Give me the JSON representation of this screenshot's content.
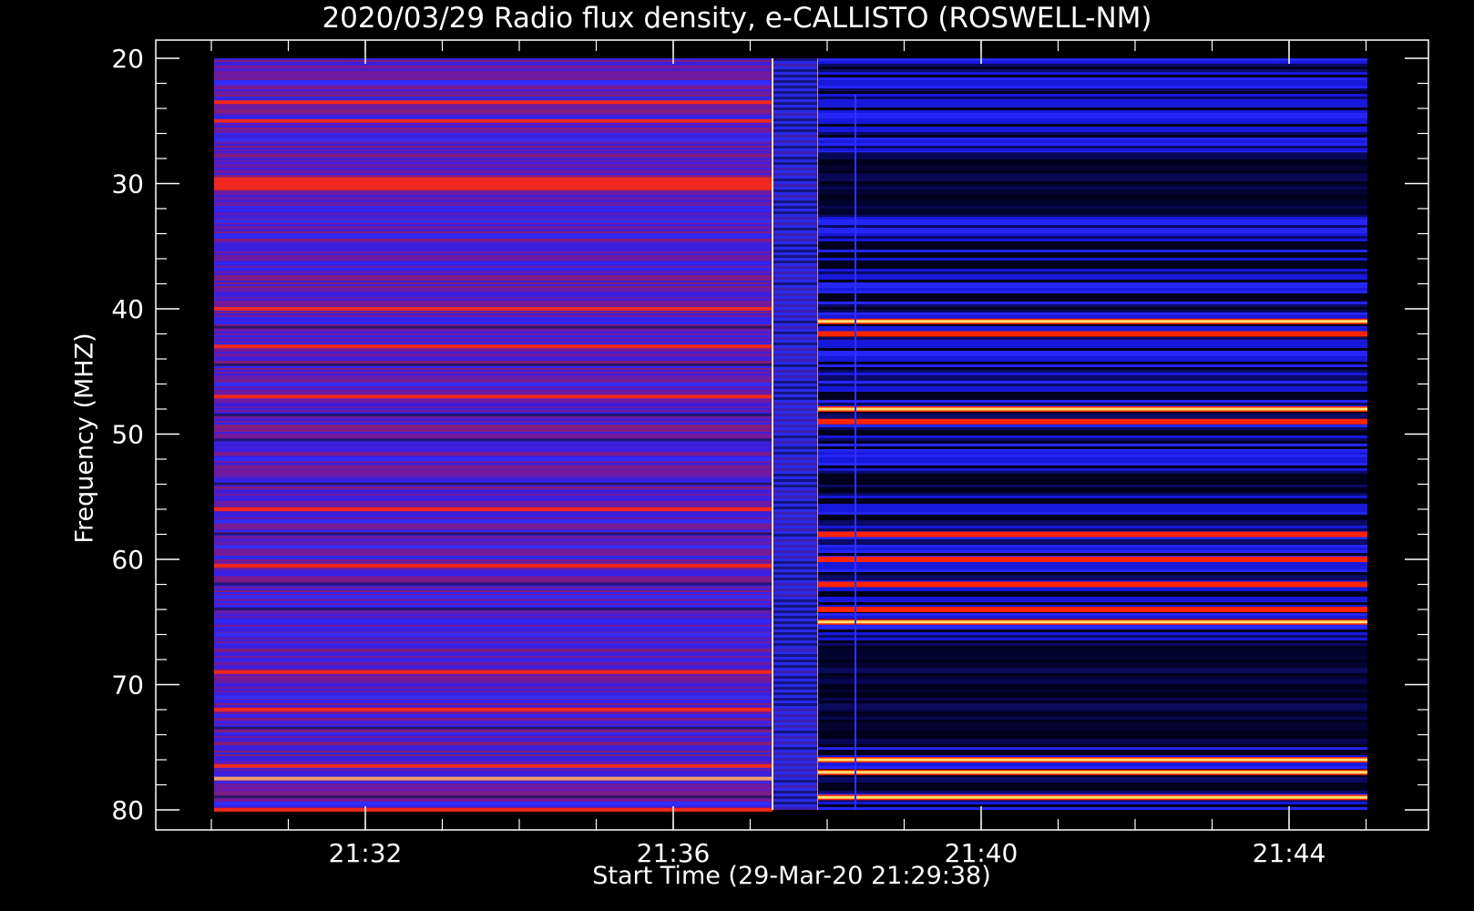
{
  "chart_data": {
    "type": "heatmap",
    "title": "2020/03/29  Radio flux density, e-CALLISTO (ROSWELL-NM)",
    "xlabel": "Start Time (29-Mar-20 21:29:38)",
    "ylabel": "Frequency (MHZ)",
    "x_ticks": [
      "21:32",
      "21:36",
      "21:40",
      "21:44"
    ],
    "y_ticks": [
      20,
      30,
      40,
      50,
      60,
      70,
      80
    ],
    "ylim": [
      80,
      20
    ],
    "x_range_min": [
      "21:29:38",
      "21:45:00"
    ],
    "colors": {
      "background": "#000000",
      "low": "#000000",
      "mid": "#2020ff",
      "high": "#ff2000",
      "peak": "#ffff80"
    },
    "features": {
      "receiver_switch_time": "21:37:50",
      "bright_bands_mhz_after_switch": [
        41,
        42,
        48,
        49,
        58,
        60,
        62,
        64,
        65,
        76,
        77,
        79
      ],
      "bright_bands_mhz_before_switch": [
        23.5,
        25,
        30,
        40,
        43,
        47,
        56,
        60.5,
        69,
        72,
        76.5,
        77.5,
        80
      ]
    }
  }
}
